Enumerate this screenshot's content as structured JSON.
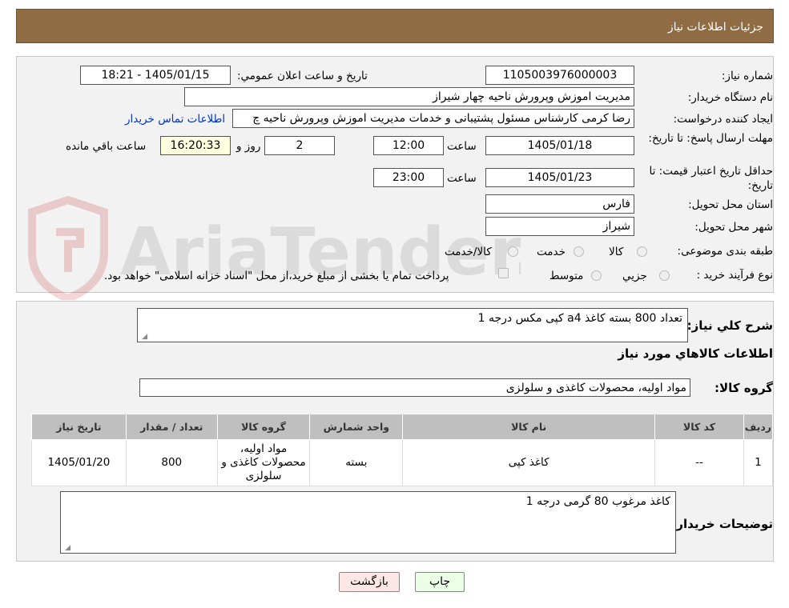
{
  "header": {
    "title": "جزئیات اطلاعات نیاز"
  },
  "watermark": {
    "text": "AriaTender.neT"
  },
  "form": {
    "need_number_label": "شماره نیاز:",
    "need_number": "1105003976000003",
    "announce_label": "تاریخ و ساعت اعلان عمومي:",
    "announce_value": "1405/01/15 - 18:21",
    "buyer_org_label": "نام دستگاه خریدار:",
    "buyer_org": "مدیریت اموزش وپرورش ناحیه چهار شیراز",
    "creator_label": "ایجاد کننده درخواست:",
    "creator": "رضا کرمی کارشناس مسئول پشتیبانی و خدمات مدیریت اموزش وپرورش ناحیه چ",
    "contact_link": "اطلاعات تماس خریدار",
    "deadline_label": "مهلت ارسال پاسخ: تا تاریخ:",
    "deadline_date": "1405/01/18",
    "time_label": "ساعت",
    "deadline_time": "12:00",
    "days_value": "2",
    "days_label": "روز و",
    "remaining_time": "16:20:33",
    "remaining_label": "ساعت باقي مانده",
    "validity_label": "حداقل تاریخ اعتبار قیمت: تا تاریخ:",
    "validity_date": "1405/01/23",
    "validity_time": "23:00",
    "province_label": "استان محل تحویل:",
    "province": "فارس",
    "city_label": "شهر محل تحویل:",
    "city": "شیراز",
    "category_label": "طبقه بندی موضوعی:",
    "category_options": [
      "کالا",
      "خدمت",
      "کالا/خدمت"
    ],
    "process_label": "نوع فرآیند خرید :",
    "process_options": [
      "جزیي",
      "متوسط"
    ],
    "treasury_text": "پرداخت تمام یا بخشی از مبلغ خرید،از محل \"اسناد خزانه اسلامی\" خواهد بود."
  },
  "details": {
    "summary_label": "شرح کلي نياز:",
    "summary": "تعداد 800 بسته کاغذ  a4 کپی مکس درجه 1",
    "goods_info_title": "اطلاعات کالاهاي مورد نياز",
    "group_label": "گروه کالا:",
    "group_value": "مواد اولیه، محصولات کاغذی و سلولزی",
    "table": {
      "headers": [
        "رديف",
        "کد کالا",
        "نام کالا",
        "واحد شمارش",
        "گروه کالا",
        "تعداد / مقدار",
        "تاريخ نياز"
      ],
      "rows": [
        [
          "1",
          "--",
          "کاغذ کپی",
          "بسته",
          "مواد اولیه، محصولات کاغذی و سلولزی",
          "800",
          "1405/01/20"
        ]
      ]
    },
    "buyer_notes_label": "توضیحات خریدار:",
    "buyer_notes": "کاغذ مرغوب 80 گرمی درجه 1"
  },
  "buttons": {
    "print": "چاپ",
    "back": "بازگشت"
  },
  "colors": {
    "header_bg": "#8f6c43",
    "print_bg": "#eaffe6",
    "back_bg": "#ffe6e6",
    "link": "#0033cc"
  }
}
